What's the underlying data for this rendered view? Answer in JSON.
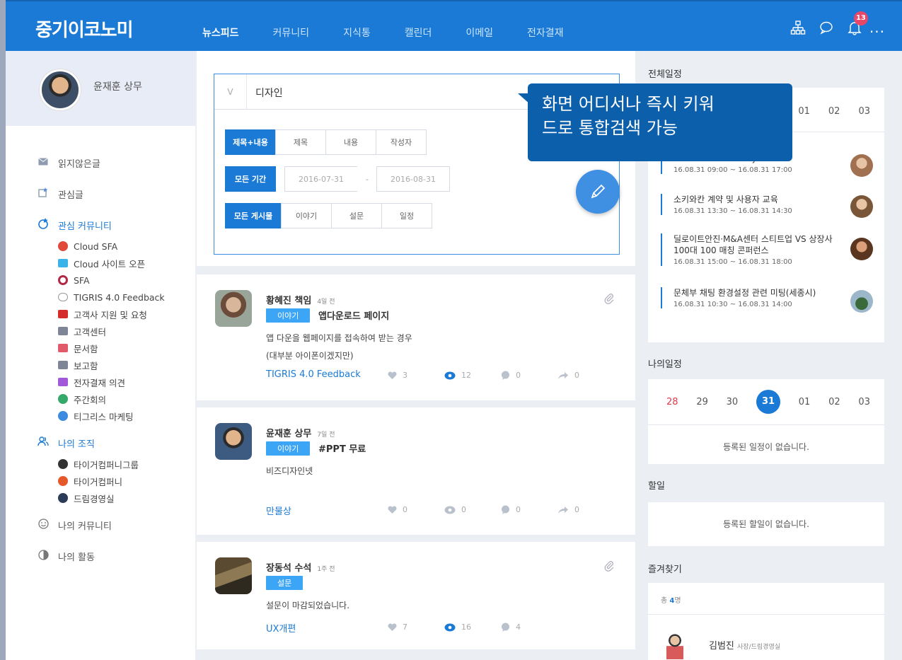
{
  "app": {
    "logo": "중기이코노미",
    "notif_count": "13",
    "more": "...",
    "nav": [
      "뉴스피드",
      "커뮤니티",
      "지식통",
      "캘린더",
      "이메일",
      "전자결재"
    ]
  },
  "profile": {
    "name": "윤재훈 상무"
  },
  "sidebar": {
    "unread": "읽지않은글",
    "favorites": "관심글",
    "interest_community": "관심 커뮤니티",
    "interest_items": [
      "Cloud SFA",
      "Cloud 사이트 오픈",
      "SFA",
      "TIGRIS 4.0 Feedback",
      "고객사 지원 및 요청",
      "고객센터",
      "문서함",
      "보고함",
      "전자결재 의견",
      "주간회의",
      "티그리스 마케팅"
    ],
    "my_org": "나의 조직",
    "org_items": [
      "타이거컴퍼니그룹",
      "타이거컴퍼니",
      "드림경영실"
    ],
    "my_community": "나의 커뮤니티",
    "my_activity": "나의 활동"
  },
  "search": {
    "toggle": "V",
    "query": "디자인",
    "scope": [
      "제목+내용",
      "제목",
      "내용",
      "작성자"
    ],
    "period_label": "모든 기간",
    "date_from": "2016-07-31",
    "date_sep": "-",
    "date_to": "2016-08-31",
    "type": [
      "모든 게시물",
      "이야기",
      "설문",
      "일정"
    ]
  },
  "tooltip": {
    "line1": "화면 어디서나 즉시 키워",
    "line2": "드로 통합검색 가능"
  },
  "posts": [
    {
      "author": "황혜진 책임",
      "time": "4일 전",
      "tag": "이야기",
      "title": "앱다운로드 페이지",
      "body1": "앱 다운을 웹페이지를 접속하여 받는 경우",
      "body2": "(대부분 아이폰이겠지만)",
      "community": "TIGRIS 4.0 Feedback",
      "likes": "3",
      "views": "12",
      "comments": "0",
      "shares": "0"
    },
    {
      "author": "윤재훈 상무",
      "time": "7일 전",
      "tag": "이야기",
      "title": "#PPT 무료",
      "body1": "비즈디자인넷",
      "community": "만물상",
      "likes": "0",
      "views": "0",
      "comments": "0",
      "shares": "0"
    },
    {
      "author": "장동석 수석",
      "time": "1주 전",
      "tag": "설문",
      "body1": "설문이 마감되었습니다.",
      "community": "UX개편",
      "likes": "7",
      "views": "16",
      "comments": "4"
    }
  ],
  "all_schedule": {
    "title": "전체일정",
    "days": [
      "01",
      "02",
      "03"
    ],
    "partial_event": "Awsome Day",
    "events": [
      {
        "date": "16.08.31 09:00 ~ 16.08.31 17:00"
      },
      {
        "title": "소키와칸 계약 및 사용자 교육",
        "date": "16.08.31 13:30 ~ 16.08.31 14:30"
      },
      {
        "title": "딜로이트안진·M&A센터 스티트업 VS 상장사 100대 100 매칭 콘퍼런스",
        "date": "16.08.31 15:00 ~ 16.08.31 18:00"
      },
      {
        "title": "문체부 채팅 환경설정 관련 미팅(세종시)",
        "date": "16.08.31 10:30 ~ 16.08.31 14:00"
      }
    ]
  },
  "my_schedule": {
    "title": "나의일정",
    "days": [
      "28",
      "29",
      "30",
      "31",
      "01",
      "02",
      "03"
    ],
    "empty": "등록된 일정이 없습니다."
  },
  "todo": {
    "title": "할일",
    "empty": "등록된 할일이 없습니다."
  },
  "bookmarks": {
    "title": "즐겨찾기",
    "total_prefix": "총 ",
    "total_count": "4",
    "total_suffix": "명",
    "person_name": "김범진",
    "person_role": "사장/드림경영실"
  }
}
